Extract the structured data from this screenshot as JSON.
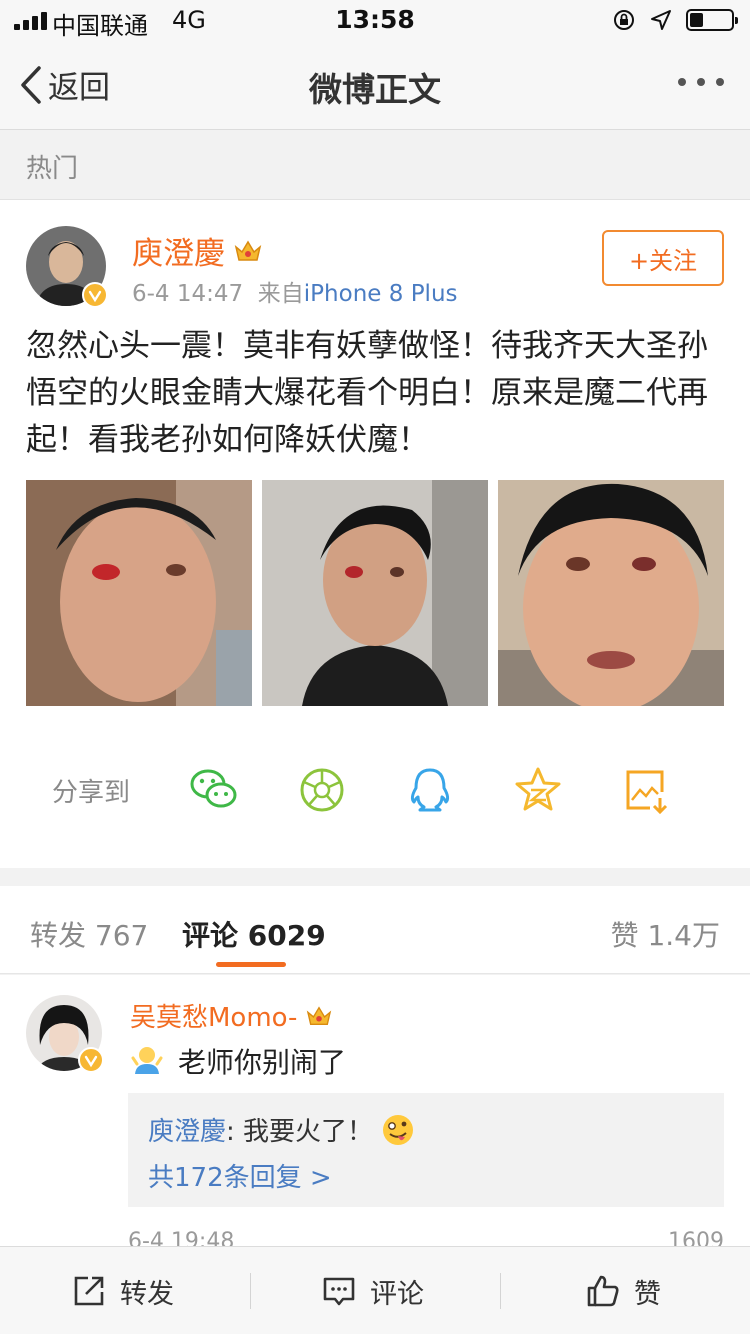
{
  "status_bar": {
    "carrier": "中国联通",
    "network": "4G",
    "time": "13:58",
    "battery_level": 0.3
  },
  "nav": {
    "back_label": "返回",
    "title": "微博正文"
  },
  "section_label": "热门",
  "post": {
    "author": "庾澄慶",
    "time": "6-4 14:47",
    "source_prefix": "来自",
    "source": "iPhone 8 Plus",
    "follow_label": "+关注",
    "text": "忽然心头一震！莫非有妖孽做怪！待我齐天大圣孙悟空的火眼金睛大爆花看个明白！原来是魔二代再起！看我老孙如何降妖伏魔！",
    "share_label": "分享到",
    "share_icons": [
      "wechat-icon",
      "moments-icon",
      "qq-icon",
      "qzone-icon",
      "save-image-icon"
    ]
  },
  "tabs": {
    "repost": "转发 767",
    "comments": "评论 6029",
    "likes": "赞 1.4万"
  },
  "comment": {
    "author": "吴莫愁Momo-",
    "text": "老师你别闹了",
    "reply_author": "庾澄慶",
    "reply_text": ": 我要火了！",
    "reply_more": "共172条回复 >",
    "time": "6-4 19:48",
    "like_count": "1609"
  },
  "bottom_bar": {
    "repost": "转发",
    "comment": "评论",
    "like": "赞"
  },
  "colors": {
    "accent_orange": "#f26c21",
    "link_blue": "#4a7cc2",
    "gold_badge": "#f7b733"
  }
}
